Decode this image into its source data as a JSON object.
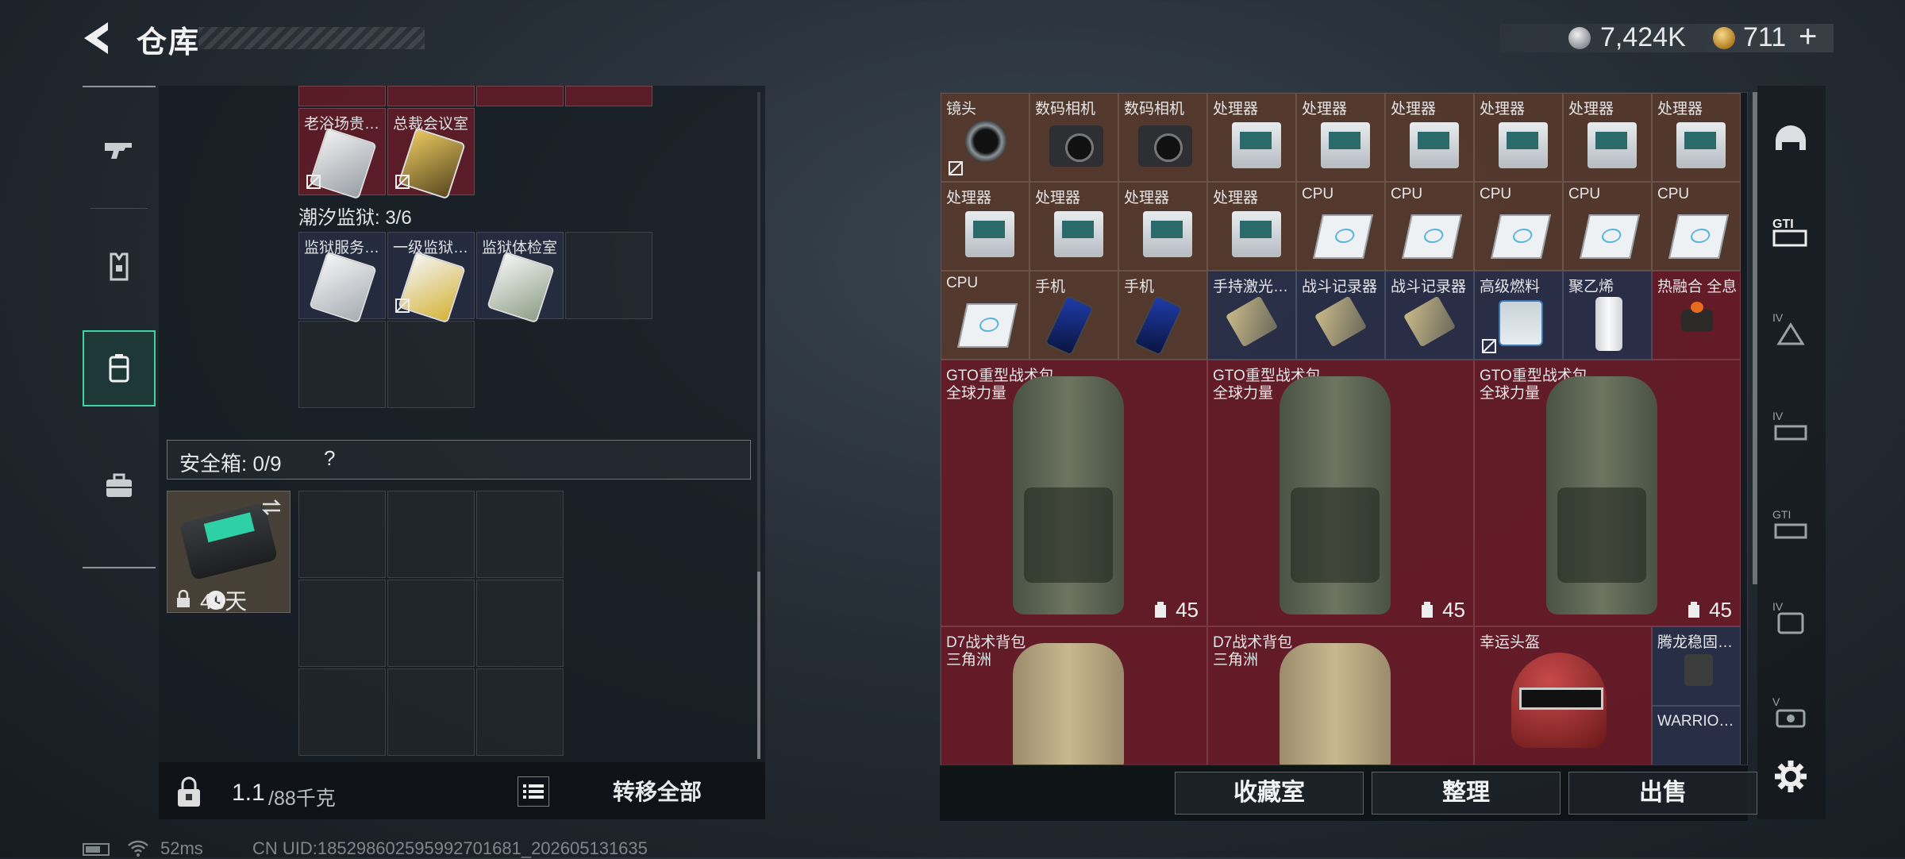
{
  "header": {
    "title": "仓库",
    "back_icon": "back-arrow-icon",
    "silver_amount": "7,424K",
    "gold_amount": "711",
    "gold_plus": "+"
  },
  "left_nav": {
    "items": [
      {
        "name": "weapon",
        "icon": "gun-icon",
        "active": false
      },
      {
        "name": "armor",
        "icon": "vest-icon",
        "active": false
      },
      {
        "name": "storage",
        "icon": "backpack-icon",
        "active": true
      },
      {
        "name": "briefcase",
        "icon": "briefcase-icon",
        "active": false
      }
    ]
  },
  "left_panel": {
    "keycards_top": [
      {
        "label": "老浴场贵…",
        "color": "red",
        "no_sell": true
      },
      {
        "label": "总裁会议室",
        "color": "red",
        "no_sell": true
      }
    ],
    "prison_label": "潮汐监狱: 3/6",
    "prison_cards": [
      {
        "label": "监狱服务…",
        "color": "blue",
        "no_sell": false
      },
      {
        "label": "一级监狱…",
        "color": "blue",
        "no_sell": true
      },
      {
        "label": "监狱体检室",
        "color": "blue",
        "no_sell": false
      }
    ],
    "safebox": {
      "label": "安全箱: 0/9",
      "help": "?",
      "days_left": "43天"
    },
    "footer": {
      "weight_current": "1.1",
      "weight_max": "/88千克",
      "transfer_all": "转移全部"
    }
  },
  "right_panel": {
    "row1": [
      {
        "label": "镜头",
        "icon": "lens",
        "no_sell": true
      },
      {
        "label": "数码相机",
        "icon": "camera"
      },
      {
        "label": "数码相机",
        "icon": "camera"
      },
      {
        "label": "处理器",
        "icon": "pcb"
      },
      {
        "label": "处理器",
        "icon": "pcb"
      },
      {
        "label": "处理器",
        "icon": "pcb"
      },
      {
        "label": "处理器",
        "icon": "pcb"
      },
      {
        "label": "处理器",
        "icon": "pcb"
      },
      {
        "label": "处理器",
        "icon": "pcb"
      }
    ],
    "row2": [
      {
        "label": "处理器",
        "icon": "pcb"
      },
      {
        "label": "处理器",
        "icon": "pcb"
      },
      {
        "label": "处理器",
        "icon": "pcb"
      },
      {
        "label": "处理器",
        "icon": "pcb"
      },
      {
        "label": "CPU",
        "icon": "cpu"
      },
      {
        "label": "CPU",
        "icon": "cpu"
      },
      {
        "label": "CPU",
        "icon": "cpu"
      },
      {
        "label": "CPU",
        "icon": "cpu"
      },
      {
        "label": "CPU",
        "icon": "cpu"
      }
    ],
    "row3": [
      {
        "label": "CPU",
        "icon": "cpu",
        "color": "brown"
      },
      {
        "label": "手机",
        "icon": "phone",
        "color": "brown"
      },
      {
        "label": "手机",
        "icon": "phone",
        "color": "brown"
      },
      {
        "label": "手持激光…",
        "icon": "recorder",
        "color": "blue"
      },
      {
        "label": "战斗记录器",
        "icon": "recorder",
        "color": "blue"
      },
      {
        "label": "战斗记录器",
        "icon": "recorder",
        "color": "blue"
      },
      {
        "label": "高级燃料",
        "icon": "fuel",
        "color": "blue",
        "no_sell": true
      },
      {
        "label": "聚乙烯",
        "icon": "poly",
        "color": "blue"
      },
      {
        "label": "热融合 全息",
        "icon": "fusion",
        "color": "red"
      }
    ],
    "backpacks": [
      {
        "name": "GTO重型战术包",
        "subtitle": "全球力量",
        "count": "45"
      },
      {
        "name": "GTO重型战术包",
        "subtitle": "全球力量",
        "count": "45"
      },
      {
        "name": "GTO重型战术包",
        "subtitle": "全球力量",
        "count": "45"
      }
    ],
    "row5": [
      {
        "name": "D7战术背包",
        "subtitle": "三角洲"
      },
      {
        "name": "D7战术背包",
        "subtitle": "三角洲"
      },
      {
        "name": "幸运头盔",
        "subtitle": ""
      },
      {
        "name": "腾龙稳固…",
        "subtitle": ""
      }
    ],
    "warrior_label": "WARRIO…",
    "footer_buttons": {
      "collection": "收藏室",
      "sort": "整理",
      "sell": "出售"
    }
  },
  "right_rail": {
    "icons": [
      "helmet-slot-icon",
      "gti-slot-icon",
      "iv-armor-slot-icon",
      "iv-rig-slot-icon",
      "gti-rig-slot-icon",
      "iv-backpack-slot-icon",
      "v-case-slot-icon",
      "settings-gear-icon"
    ]
  },
  "status_bar": {
    "ping": "52ms",
    "uid": "CN UID:185298602595992701681_202605131635"
  },
  "colors": {
    "accent": "#3fd3a7",
    "red_slot": "#701c28",
    "blue_slot": "#30365a",
    "brown_slot": "#5f3e30"
  }
}
